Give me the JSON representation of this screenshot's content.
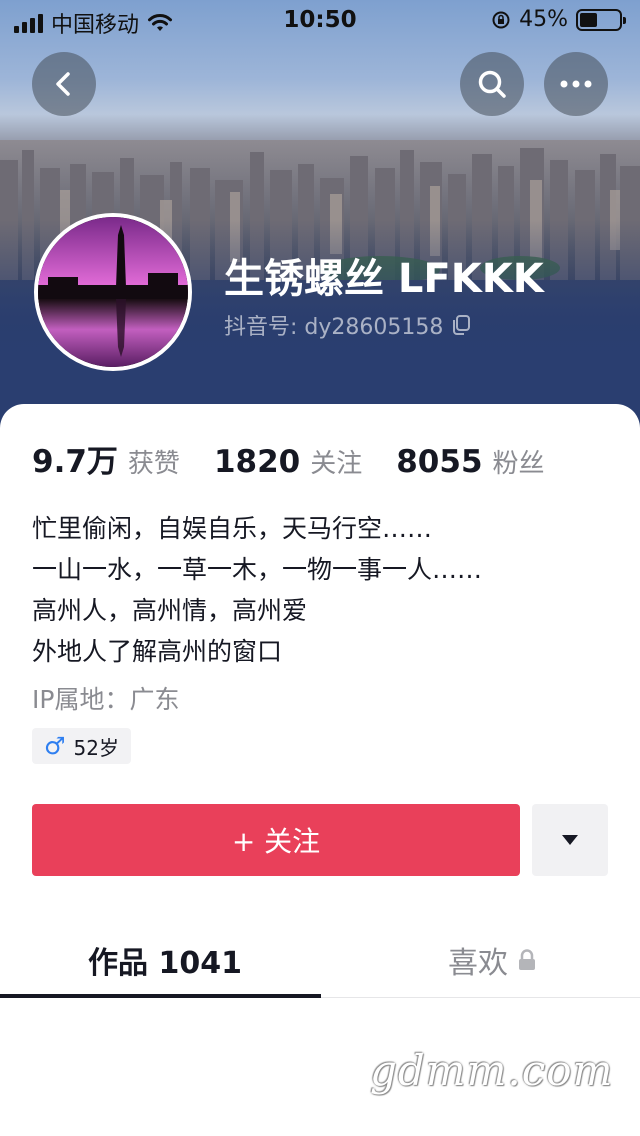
{
  "status_bar": {
    "carrier": "中国移动",
    "time": "10:50",
    "battery": "45%",
    "battery_level": 0.45
  },
  "header": {
    "back_icon": "chevron-left-icon",
    "search_icon": "search-icon",
    "more_icon": "more-horizontal-icon"
  },
  "profile": {
    "nickname": "生锈螺丝 LFKKK",
    "douyin_id": "抖音号: dy28605158",
    "copy_icon": "copy-icon"
  },
  "stats": [
    {
      "value": "9.7万",
      "label": "获赞"
    },
    {
      "value": "1820",
      "label": "关注"
    },
    {
      "value": "8055",
      "label": "粉丝"
    }
  ],
  "bio": {
    "lines": [
      "忙里偷闲，自娱自乐，天马行空……",
      "一山一水，一草一木，一物一事一人……",
      "高州人，高州情，高州爱",
      "外地人了解高州的窗口"
    ],
    "ip": "IP属地：广东",
    "gender_symbol": "♂",
    "age": "52岁"
  },
  "actions": {
    "follow_label": "+ 关注",
    "more_icon": "triangle-down-icon"
  },
  "tabs": [
    {
      "label": "作品 1041"
    },
    {
      "label": "喜欢",
      "icon": "lock-icon"
    }
  ],
  "watermark": "gdmm.com",
  "colors": {
    "accent": "#e9405a",
    "male_icon": "#2f7ff0"
  }
}
